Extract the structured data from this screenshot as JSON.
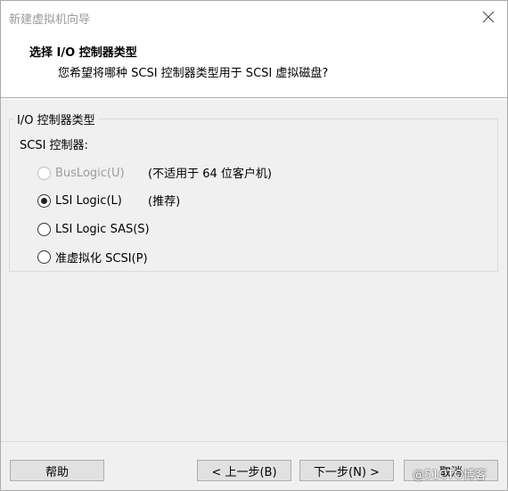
{
  "window": {
    "title": "新建虚拟机向导"
  },
  "header": {
    "title": "选择 I/O 控制器类型",
    "subtitle": "您希望将哪种 SCSI 控制器类型用于 SCSI 虚拟磁盘?"
  },
  "group": {
    "legend": "I/O 控制器类型",
    "scsi_label": "SCSI 控制器:",
    "options": [
      {
        "label": "BusLogic(U)",
        "note": "(不适用于 64 位客户机)",
        "selected": false,
        "disabled": true
      },
      {
        "label": "LSI Logic(L)",
        "note": "(推荐)",
        "selected": true,
        "disabled": false
      },
      {
        "label": "LSI Logic SAS(S)",
        "note": "",
        "selected": false,
        "disabled": false
      },
      {
        "label": "准虚拟化 SCSI(P)",
        "note": "",
        "selected": false,
        "disabled": false
      }
    ]
  },
  "buttons": {
    "help": "帮助",
    "back": "< 上一步(B)",
    "next": "下一步(N) >",
    "cancel": "取消"
  },
  "watermark": "@51CTO博客",
  "icons": {
    "close": "close-icon"
  }
}
